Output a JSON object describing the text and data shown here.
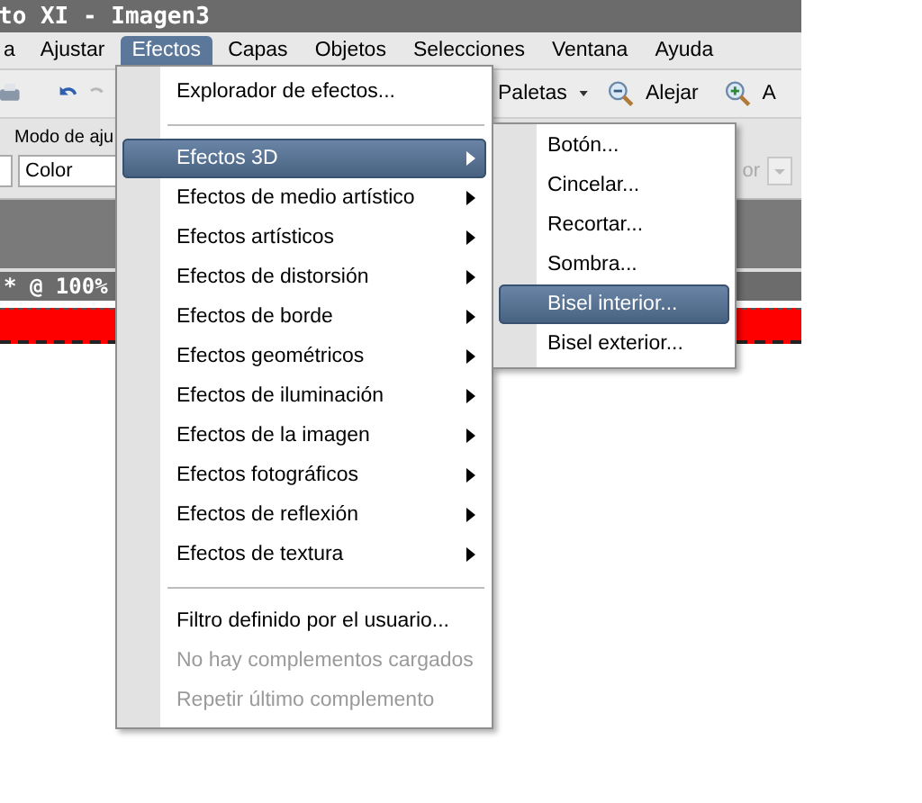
{
  "window": {
    "title": "to XI - Imagen3"
  },
  "menu_bar": [
    {
      "label": "a",
      "selected": false
    },
    {
      "label": "Ajustar",
      "selected": false
    },
    {
      "label": "Efectos",
      "selected": true
    },
    {
      "label": "Capas",
      "selected": false
    },
    {
      "label": "Objetos",
      "selected": false
    },
    {
      "label": "Selecciones",
      "selected": false
    },
    {
      "label": "Ventana",
      "selected": false
    },
    {
      "label": "Ayuda",
      "selected": false
    }
  ],
  "toolbar": {
    "palettes": "Paletas",
    "zoom_out": "Alejar",
    "zoom_in": "A"
  },
  "property_bar": {
    "label": "Modo de aju",
    "mode_value": "Color",
    "right_field": "or"
  },
  "document": {
    "title": "* @ 100%"
  },
  "menu": [
    {
      "kind": "item",
      "label": "Explorador de efectos...",
      "selected": false,
      "disabled": false
    },
    {
      "kind": "separator"
    },
    {
      "kind": "submenu",
      "label": "Efectos 3D",
      "selected": true,
      "disabled": false
    },
    {
      "kind": "submenu",
      "label": "Efectos de medio artístico",
      "selected": false,
      "disabled": false
    },
    {
      "kind": "submenu",
      "label": "Efectos artísticos",
      "selected": false,
      "disabled": false
    },
    {
      "kind": "submenu",
      "label": "Efectos de distorsión",
      "selected": false,
      "disabled": false
    },
    {
      "kind": "submenu",
      "label": "Efectos de borde",
      "selected": false,
      "disabled": false
    },
    {
      "kind": "submenu",
      "label": "Efectos geométricos",
      "selected": false,
      "disabled": false
    },
    {
      "kind": "submenu",
      "label": "Efectos de iluminación",
      "selected": false,
      "disabled": false
    },
    {
      "kind": "submenu",
      "label": "Efectos de la imagen",
      "selected": false,
      "disabled": false
    },
    {
      "kind": "submenu",
      "label": "Efectos fotográficos",
      "selected": false,
      "disabled": false
    },
    {
      "kind": "submenu",
      "label": "Efectos de reflexión",
      "selected": false,
      "disabled": false
    },
    {
      "kind": "submenu",
      "label": "Efectos de textura",
      "selected": false,
      "disabled": false
    },
    {
      "kind": "separator"
    },
    {
      "kind": "item",
      "label": "Filtro definido por el usuario...",
      "selected": false,
      "disabled": false
    },
    {
      "kind": "item",
      "label": "No hay complementos cargados",
      "selected": false,
      "disabled": true
    },
    {
      "kind": "item",
      "label": "Repetir último complemento",
      "selected": false,
      "disabled": true
    }
  ],
  "submenu": [
    {
      "label": "Botón...",
      "selected": false
    },
    {
      "label": "Cincelar...",
      "selected": false
    },
    {
      "label": "Recortar...",
      "selected": false
    },
    {
      "label": "Sombra...",
      "selected": false
    },
    {
      "label": "Bisel interior...",
      "selected": true
    },
    {
      "label": "Bisel exterior...",
      "selected": false
    }
  ]
}
